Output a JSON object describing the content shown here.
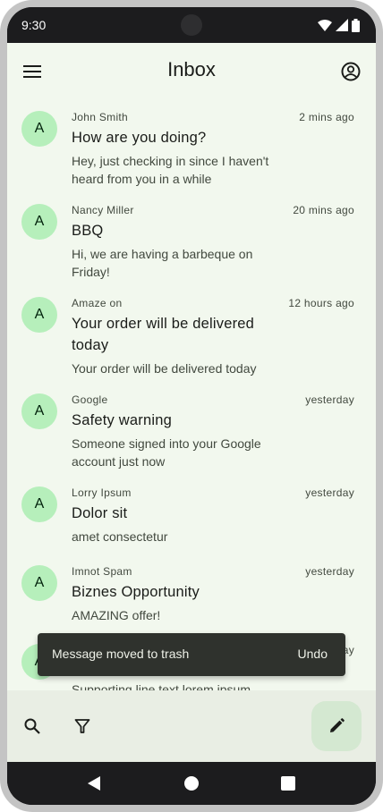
{
  "status": {
    "time": "9:30"
  },
  "header": {
    "title": "Inbox"
  },
  "messages": [
    {
      "avatar": "A",
      "sender": "John Smith",
      "time": "2 mins ago",
      "subject": "How are you doing?",
      "preview": "Hey, just checking in since I haven't heard from you in a while"
    },
    {
      "avatar": "A",
      "sender": "Nancy Miller",
      "time": "20 mins ago",
      "subject": "BBQ",
      "preview": "Hi, we are having a barbeque on Friday!"
    },
    {
      "avatar": "A",
      "sender": "Amaze on",
      "time": "12 hours ago",
      "subject": "Your order will be delivered today",
      "preview": "Your order will be delivered today"
    },
    {
      "avatar": "A",
      "sender": "Google",
      "time": "yesterday",
      "subject": "Safety warning",
      "preview": "Someone signed into your Google account just now"
    },
    {
      "avatar": "A",
      "sender": "Lorry Ipsum",
      "time": "yesterday",
      "subject": "Dolor sit",
      "preview": "amet consectetur"
    },
    {
      "avatar": "A",
      "sender": "Imnot Spam",
      "time": "yesterday",
      "subject": "Biznes Opportunity",
      "preview": "AMAZING offer!"
    },
    {
      "avatar": "A",
      "sender": "",
      "time": "yesterday",
      "subject": "",
      "preview": "Supporting line text lorem ipsum"
    }
  ],
  "snackbar": {
    "message": "Message moved to trash",
    "action": "Undo"
  },
  "icons": {
    "menu": "menu-icon",
    "account": "account-circle-icon",
    "search": "search-icon",
    "filter": "filter-icon",
    "compose": "pencil-icon",
    "back": "back-triangle-icon",
    "home": "home-circle-icon",
    "recents": "recents-square-icon"
  },
  "colors": {
    "background": "#f2f8ee",
    "avatar": "#b6efbb",
    "fab": "#d4e8d1",
    "snackbar": "#2f322d"
  }
}
